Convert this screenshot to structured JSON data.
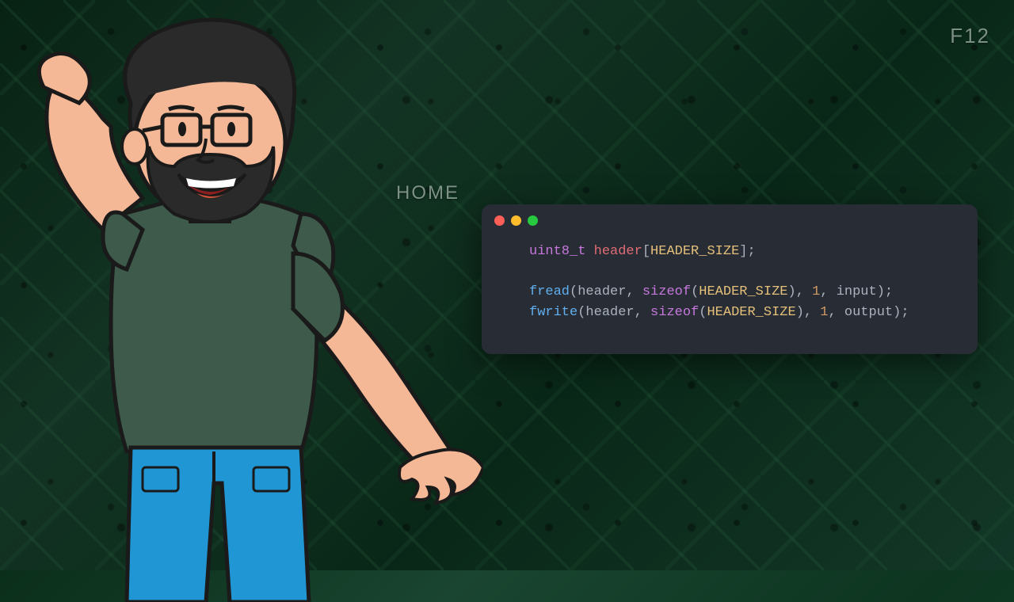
{
  "pcb": {
    "label_home": "HOME",
    "label_f12": "F12"
  },
  "window": {
    "dots": {
      "red": "#ff5f56",
      "yellow": "#ffbd2e",
      "green": "#27c93f"
    }
  },
  "code": {
    "line1": {
      "type": "uint8_t",
      "var": "header",
      "lbrack": "[",
      "const": "HEADER_SIZE",
      "rbrack_semi": "];"
    },
    "line2": {
      "func": "fread",
      "open": "(",
      "arg1": "header",
      "c1": ", ",
      "sizeof": "sizeof",
      "sopen": "(",
      "sarg": "HEADER_SIZE",
      "sclose": ")",
      "c2": ", ",
      "num": "1",
      "c3": ", ",
      "arg4": "input",
      "close": ");"
    },
    "line3": {
      "func": "fwrite",
      "open": "(",
      "arg1": "header",
      "c1": ", ",
      "sizeof": "sizeof",
      "sopen": "(",
      "sarg": "HEADER_SIZE",
      "sclose": ")",
      "c2": ", ",
      "num": "1",
      "c3": ", ",
      "arg4": "output",
      "close": ");"
    }
  }
}
